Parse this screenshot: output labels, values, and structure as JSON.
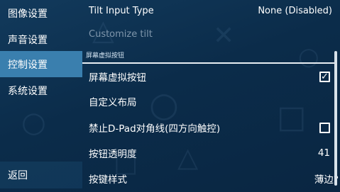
{
  "sidebar": {
    "items": [
      {
        "label": "图像设置"
      },
      {
        "label": "声音设置"
      },
      {
        "label": "控制设置"
      },
      {
        "label": "系统设置"
      }
    ],
    "active_index": 2,
    "back_label": "返回"
  },
  "settings": {
    "tilt_input_type": {
      "label": "Tilt Input Type",
      "value": "None (Disabled)"
    },
    "customize_tilt": {
      "label": "Customize tilt"
    },
    "section_title": "屏幕虚拟按钮",
    "show_touch_controls": {
      "label": "屏幕虚拟按钮",
      "checked": true
    },
    "custom_layout": {
      "label": "自定义布局"
    },
    "disable_dpad_diagonals": {
      "label": "禁止D-Pad对角线(四方向触控)",
      "checked": false
    },
    "button_opacity": {
      "label": "按钮透明度",
      "value": "41"
    },
    "button_style": {
      "label": "按键样式",
      "value": "薄边?"
    }
  },
  "colors": {
    "active_sidebar": "#3a7fae",
    "background": "#0b2c4a",
    "disabled_text": "#7f96ab"
  }
}
